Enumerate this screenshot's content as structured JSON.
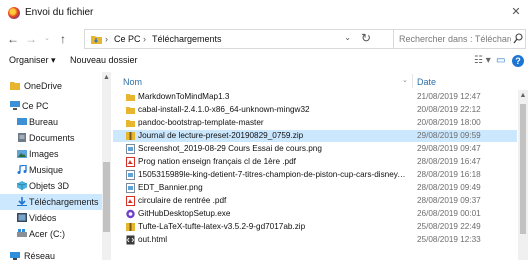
{
  "window": {
    "title": "Envoi du fichier",
    "close_glyph": "✕"
  },
  "nav": {
    "back": "←",
    "forward": "→",
    "up": "↑"
  },
  "address": {
    "separator": "›",
    "crumbs": [
      "Ce PC",
      "Téléchargements"
    ],
    "dropdown": "⌄",
    "refresh": "↻"
  },
  "search": {
    "placeholder": "Rechercher dans : Téléchargem..."
  },
  "toolbar": {
    "organize": "Organiser ▾",
    "new_folder": "Nouveau dossier",
    "view_glyph": "☷ ▾",
    "pane_glyph": "▭",
    "help": "?"
  },
  "sidebar": {
    "items": [
      {
        "label": "OneDrive",
        "icon": "onedrive-icon"
      },
      {
        "label": "Ce PC",
        "icon": "pc-icon"
      },
      {
        "label": "Bureau",
        "icon": "desktop-icon"
      },
      {
        "label": "Documents",
        "icon": "documents-icon"
      },
      {
        "label": "Images",
        "icon": "pictures-icon"
      },
      {
        "label": "Musique",
        "icon": "music-icon"
      },
      {
        "label": "Objets 3D",
        "icon": "objects3d-icon"
      },
      {
        "label": "Téléchargements",
        "icon": "downloads-icon",
        "selected": true
      },
      {
        "label": "Vidéos",
        "icon": "videos-icon"
      },
      {
        "label": "Acer (C:)",
        "icon": "drive-icon"
      },
      {
        "label": "Réseau",
        "icon": "network-icon"
      }
    ]
  },
  "files": {
    "headers": {
      "name": "Nom",
      "date": "Date"
    },
    "rows": [
      {
        "name": "MarkdownToMindMap1.3",
        "date": "21/08/2019 12:47",
        "type": "folder"
      },
      {
        "name": "cabal-install-2.4.1.0-x86_64-unknown-mingw32",
        "date": "20/08/2019 22:12",
        "type": "folder"
      },
      {
        "name": "pandoc-bootstrap-template-master",
        "date": "20/08/2019 18:00",
        "type": "folder"
      },
      {
        "name": "Journal de lecture-preset-20190829_0759.zip",
        "date": "29/08/2019 09:59",
        "type": "zip",
        "selected": true
      },
      {
        "name": "Screenshot_2019-08-29 Cours Essai de cours.png",
        "date": "29/08/2019 09:47",
        "type": "image"
      },
      {
        "name": "Prog nation enseign français cl de 1ère .pdf",
        "date": "28/08/2019 16:47",
        "type": "pdf"
      },
      {
        "name": "1505315989le-king-detient-7-titres-champion-de-piston-cup-cars-disney.j...",
        "date": "28/08/2019 16:18",
        "type": "image"
      },
      {
        "name": "EDT_Bannier.png",
        "date": "28/08/2019 09:49",
        "type": "image"
      },
      {
        "name": "circulaire de rentrée .pdf",
        "date": "28/08/2019 09:37",
        "type": "pdf"
      },
      {
        "name": "GitHubDesktopSetup.exe",
        "date": "26/08/2019 00:01",
        "type": "exe"
      },
      {
        "name": "Tufte-LaTeX-tufte-latex-v3.5.2-9-gd7017ab.zip",
        "date": "25/08/2019 22:49",
        "type": "zip"
      },
      {
        "name": "out.html",
        "date": "25/08/2019 12:33",
        "type": "html"
      }
    ]
  },
  "colors": {
    "selection": "#cce8ff",
    "accent": "#1e76d3",
    "folder": "#e8b52e"
  }
}
